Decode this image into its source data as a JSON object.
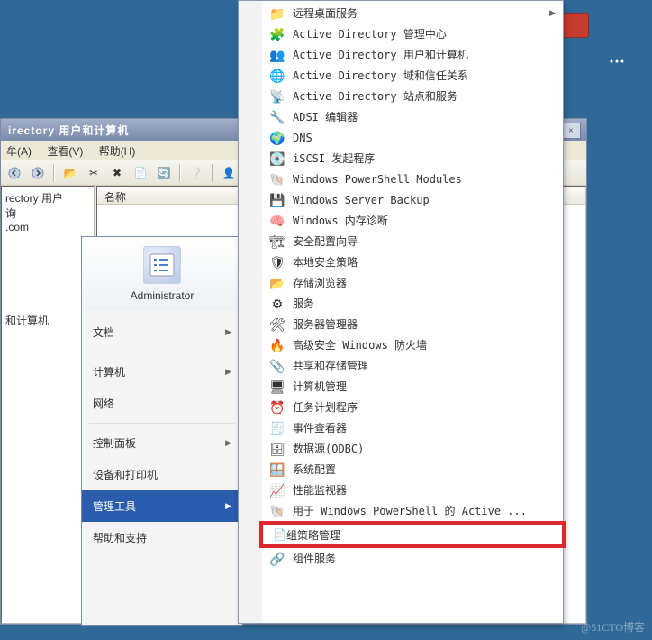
{
  "colors": {
    "highlight_red": "#d92b2b"
  },
  "mmc": {
    "title": "irectory 用户和计算机",
    "btn_min": "_",
    "btn_max": "□",
    "btn_close": "×",
    "menu": {
      "file_frag": "牟(A)",
      "view": "查看(V)",
      "help": "帮助(H)"
    },
    "tree": {
      "line1": "rectory 用户",
      "line2": "询",
      "line3": ".com",
      "line4": "",
      "line5": "和计算机"
    },
    "list_header": "名称"
  },
  "startmenu": {
    "head_label": "Administrator",
    "items": [
      {
        "label": "文档",
        "arrow": true,
        "sel": false
      },
      {
        "sep": true
      },
      {
        "label": "计算机",
        "arrow": true,
        "sel": false
      },
      {
        "label": "网络",
        "arrow": false,
        "sel": false
      },
      {
        "sep": true
      },
      {
        "label": "控制面板",
        "arrow": true,
        "sel": false
      },
      {
        "label": "设备和打印机",
        "arrow": false,
        "sel": false
      },
      {
        "label": "管理工具",
        "arrow": true,
        "sel": true
      },
      {
        "label": "帮助和支持",
        "arrow": false,
        "sel": false
      }
    ]
  },
  "submenu": {
    "items": [
      {
        "ic": "📁",
        "label": "远程桌面服务",
        "arrow": true
      },
      {
        "ic": "🧩",
        "label": "Active Directory 管理中心"
      },
      {
        "ic": "👥",
        "label": "Active Directory 用户和计算机"
      },
      {
        "ic": "🌐",
        "label": "Active Directory 域和信任关系"
      },
      {
        "ic": "📡",
        "label": "Active Directory 站点和服务"
      },
      {
        "ic": "🔧",
        "label": "ADSI 编辑器"
      },
      {
        "ic": "🌍",
        "label": "DNS"
      },
      {
        "ic": "💽",
        "label": "iSCSI 发起程序"
      },
      {
        "ic": "🐚",
        "label": "Windows PowerShell Modules"
      },
      {
        "ic": "💾",
        "label": "Windows Server Backup"
      },
      {
        "ic": "🧠",
        "label": "Windows 内存诊断"
      },
      {
        "ic": "🏗",
        "label": "安全配置向导"
      },
      {
        "ic": "🛡",
        "label": "本地安全策略"
      },
      {
        "ic": "📂",
        "label": "存储浏览器"
      },
      {
        "ic": "⚙",
        "label": "服务"
      },
      {
        "ic": "🛠",
        "label": "服务器管理器"
      },
      {
        "ic": "🔥",
        "label": "高级安全 Windows 防火墙"
      },
      {
        "ic": "📎",
        "label": "共享和存储管理"
      },
      {
        "ic": "🖥",
        "label": "计算机管理"
      },
      {
        "ic": "⏰",
        "label": "任务计划程序"
      },
      {
        "ic": "🧾",
        "label": "事件查看器"
      },
      {
        "ic": "🗄",
        "label": "数据源(ODBC)"
      },
      {
        "ic": "🪟",
        "label": "系统配置"
      },
      {
        "ic": "📈",
        "label": "性能监视器"
      },
      {
        "ic": "🐚",
        "label": "用于 Windows PowerShell 的 Active ..."
      },
      {
        "ic": "📄",
        "label": "组策略管理",
        "red": true
      },
      {
        "ic": "🔗",
        "label": "组件服务"
      }
    ]
  },
  "watermark": "@51CTO博客"
}
